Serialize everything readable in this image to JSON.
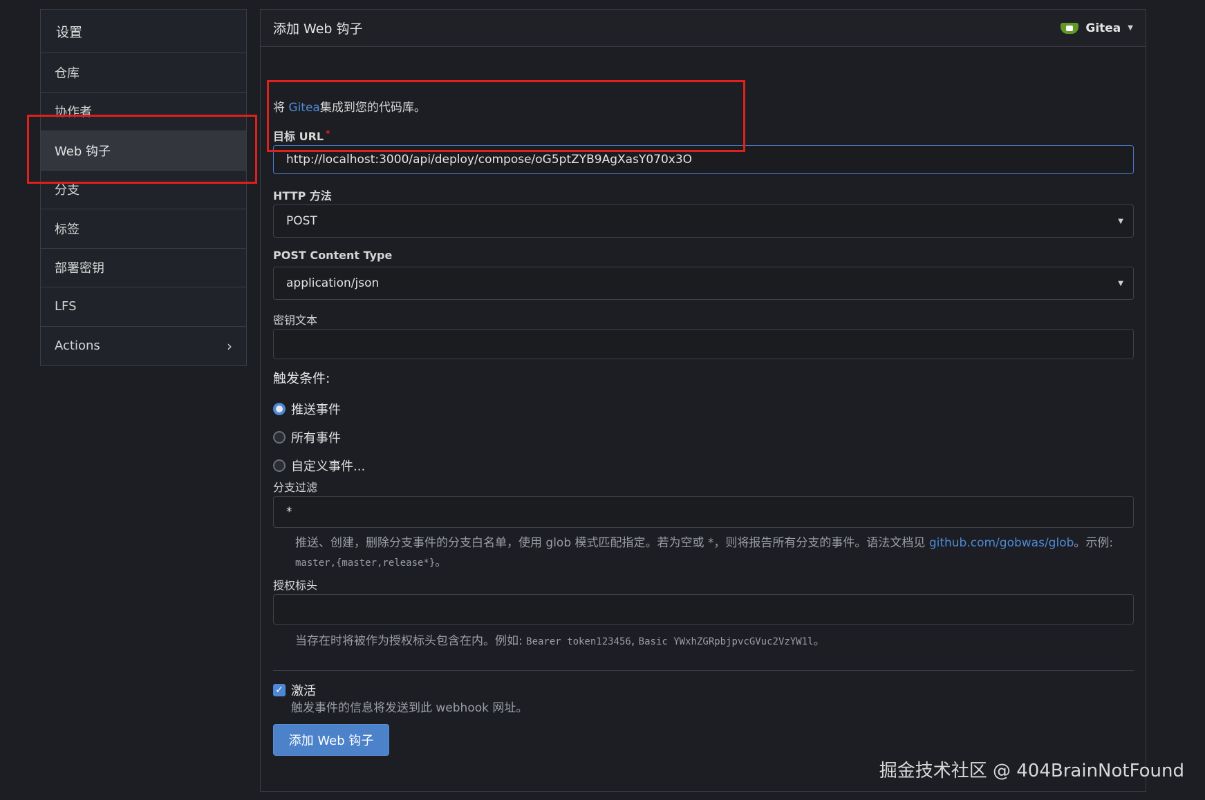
{
  "sidebar": {
    "items": [
      {
        "label": "设置"
      },
      {
        "label": "仓库"
      },
      {
        "label": "协作者"
      },
      {
        "label": "Web 钩子"
      },
      {
        "label": "分支"
      },
      {
        "label": "标签"
      },
      {
        "label": "部署密钥"
      },
      {
        "label": "LFS"
      },
      {
        "label": "Actions"
      }
    ]
  },
  "header": {
    "title": "添加 Web 钩子",
    "type_menu": "Gitea"
  },
  "form": {
    "desc_prefix": "将 ",
    "desc_link": "Gitea",
    "desc_suffix": "集成到您的代码库。",
    "target_url_label": "目标 URL",
    "target_url_required": "*",
    "target_url_value": "http://localhost:3000/api/deploy/compose/oG5ptZYB9AgXasY070x3O",
    "http_method_label": "HTTP 方法",
    "http_method_value": "POST",
    "content_type_label": "POST Content Type",
    "content_type_value": "application/json",
    "secret_label": "密钥文本",
    "secret_value": "",
    "trigger_title": "触发条件:",
    "triggers": [
      {
        "label": "推送事件",
        "checked": true
      },
      {
        "label": "所有事件",
        "checked": false
      },
      {
        "label": "自定义事件...",
        "checked": false
      }
    ],
    "branch_filter_label": "分支过滤",
    "branch_filter_value": "*",
    "branch_help_1": "推送、创建，删除分支事件的分支白名单，使用 glob 模式匹配指定。若为空或 *，则将报告所有分支的事件。语法文档见 ",
    "branch_help_link": "github.com/gobwas/glob",
    "branch_help_2": "。示例:",
    "branch_help_example": "master,{master,release*}",
    "branch_help_end": "。",
    "auth_header_label": "授权标头",
    "auth_header_value": "",
    "auth_help_prefix": "当存在时将被作为授权标头包含在内。例如: ",
    "auth_help_example_1": "Bearer token123456",
    "auth_help_sep": ", ",
    "auth_help_example_2": "Basic YWxhZGRpbjpvcGVuc2VzYW1l",
    "auth_help_end": "。",
    "active_label": "激活",
    "active_checked": true,
    "active_help": "触发事件的信息将发送到此 webhook 网址。",
    "submit_label": "添加 Web 钩子"
  },
  "watermark": "掘金技术社区 @ 404BrainNotFound",
  "colors": {
    "accent": "#4b82c9",
    "link": "#4f8ad8",
    "highlight": "#e0201c",
    "background": "#1c1e23"
  }
}
